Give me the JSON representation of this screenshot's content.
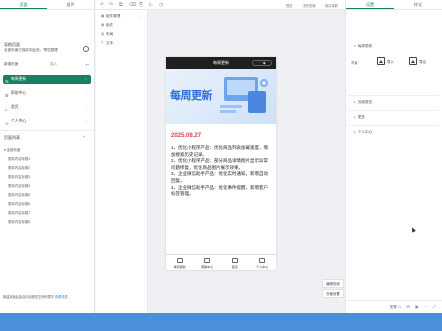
{
  "left": {
    "tabs": [
      "页面",
      "组件"
    ],
    "project_title": "导航页面",
    "project_sub": "全部页面已保存到此处，帮您整理",
    "add_label": "新增页面",
    "add2_label": "插入",
    "pages": [
      {
        "label": "每周更新",
        "icon": "☰"
      },
      {
        "label": "帮助中心",
        "icon": "☰"
      },
      {
        "label": "首页",
        "icon": "⌂"
      },
      {
        "label": "个人中心",
        "icon": "☺"
      }
    ],
    "tree_title": "页面列表",
    "tree": [
      "全部页面",
      "更新内容标题1",
      "更新内容标题2",
      "更新内容标题3",
      "更新内容标题4",
      "更新内容标题5",
      "更新内容标题6",
      "更新内容标题7",
      "更新内容标题8"
    ],
    "footer_text": "新建页面后会自动出现在左侧列表中",
    "footer_link": "查看详情"
  },
  "components": {
    "items": [
      "组件管理",
      "组件",
      "布局",
      "文本"
    ]
  },
  "toolbar": {
    "labels": [
      "预览",
      "发布配置",
      "保存草稿"
    ]
  },
  "phone": {
    "title": "每周更新",
    "capsule": "··· ◉",
    "banner_title": "每周更新",
    "date": "2025.08.27",
    "content": "1、优化小程序产品：优化商品列表加载速度，增加搜索历史记录。\n2、优化小程序产品：部分商品详情图片显示异常问题修复，优化商品图片展示效果。\n3、企业微信助手产品：优化实时通知，新增自动回复。\n4、企业微信助手产品：优化事件提醒，新增客户标签管理。",
    "tabs": [
      "每周更新",
      "帮助中心",
      "首页",
      "个人中心"
    ]
  },
  "side_buttons": [
    "编辑页面",
    "页面设置"
  ],
  "right": {
    "tabs": [
      "设置",
      "样式"
    ],
    "section_title": "每周更新",
    "field_label": "背景",
    "img1": "导入",
    "img2": "导出",
    "sections": [
      "页面属性",
      "更多",
      "个人中心"
    ],
    "footer": "配置"
  }
}
